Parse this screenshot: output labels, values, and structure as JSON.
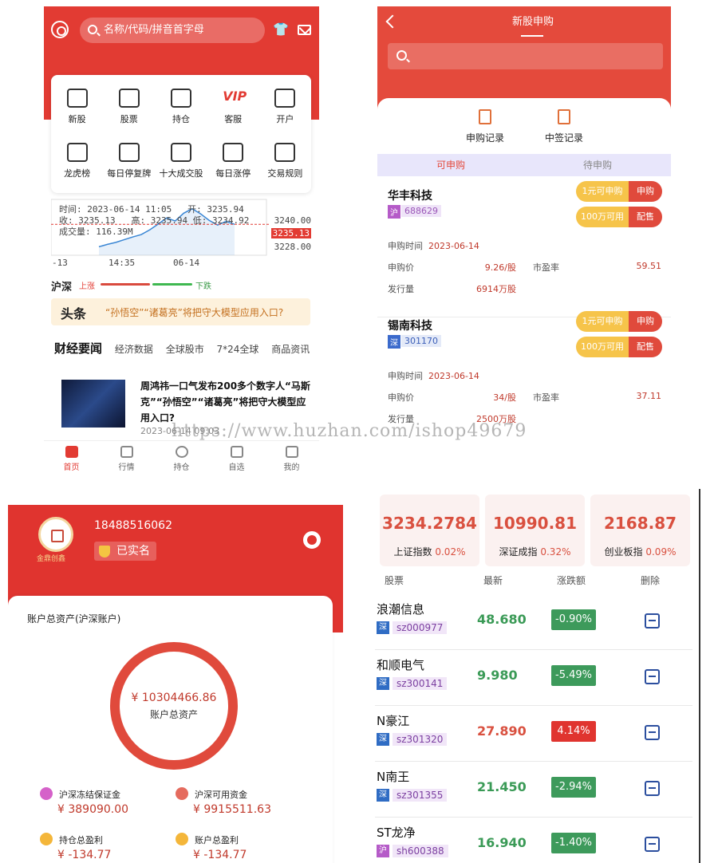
{
  "home": {
    "search_placeholder": "名称/代码/拼音首字母",
    "grid": [
      {
        "label": "新股",
        "icon": "ticket-icon"
      },
      {
        "label": "股票",
        "icon": "download-icon"
      },
      {
        "label": "持仓",
        "icon": "wallet-icon"
      },
      {
        "label": "客服",
        "icon": "vip-icon",
        "glyph": "VIP"
      },
      {
        "label": "开户",
        "icon": "user-coin-icon"
      },
      {
        "label": "龙虎榜",
        "icon": "badge-icon"
      },
      {
        "label": "每日停复牌",
        "icon": "star-icon"
      },
      {
        "label": "十大成交股",
        "icon": "crown-icon"
      },
      {
        "label": "每日涨停",
        "icon": "layers-icon"
      },
      {
        "label": "交易规则",
        "icon": "rules-icon"
      }
    ],
    "chart_info": {
      "time": "时间: 2023-06-14 11:05",
      "open": "开: 3235.94",
      "close": "收: 3235.13",
      "high": "高: 3235.94",
      "low": "低: 3234.92",
      "volume": "成交量: 116.39M"
    },
    "chart_data": {
      "type": "line",
      "x_ticks": [
        "-13",
        "14:35",
        "06-14"
      ],
      "y_ticks": [
        "3240.00",
        "3235.13",
        "3228.00"
      ],
      "current": "3235.13",
      "ylim": [
        3226,
        3242
      ],
      "values": [
        3228.5,
        3229.2,
        3229.8,
        3230.6,
        3231.4,
        3232.1,
        3233.5,
        3235.2,
        3237.0,
        3236.1,
        3238.4,
        3239.7,
        3238.2,
        3236.3,
        3234.9,
        3236.0,
        3235.13
      ]
    },
    "breadth": {
      "market": "沪深",
      "up": "上涨",
      "down": "下跌"
    },
    "banner": {
      "logo": "头条",
      "text": "“孙悟空”“诸葛亮”将把守大模型应用入口?"
    },
    "tabs": [
      "财经要闻",
      "经济数据",
      "全球股市",
      "7*24全球",
      "商品资讯"
    ],
    "news": {
      "title": "周鸿祎一口气发布200多个数字人“马斯克”“孙悟空”“诸葛亮”将把守大模型应用入口?",
      "time": "2023-06-14 09:03"
    },
    "nav": [
      "首页",
      "行情",
      "持仓",
      "自选",
      "我的"
    ]
  },
  "ipo": {
    "title": "新股申购",
    "actions": [
      "申购记录",
      "中签记录"
    ],
    "subtabs": [
      "可申购",
      "待申购"
    ],
    "items": [
      {
        "name": "华丰科技",
        "exchange": "沪",
        "code": "688629",
        "pill1_left": "1元可申购",
        "pill1_right": "申购",
        "pill2_left": "100万可用",
        "pill2_right": "配售",
        "date_label": "申购时间",
        "date": "2023-06-14",
        "price_label": "申购价",
        "price": "9.26/股",
        "pe_label": "市盈率",
        "pe": "59.51",
        "issue_label": "发行量",
        "issue": "6914万股"
      },
      {
        "name": "锡南科技",
        "exchange": "深",
        "code": "301170",
        "pill1_left": "1元可申购",
        "pill1_right": "申购",
        "pill2_left": "100万可用",
        "pill2_right": "配售",
        "date_label": "申购时间",
        "date": "2023-06-14",
        "price_label": "申购价",
        "price": "34/股",
        "pe_label": "市盈率",
        "pe": "37.11",
        "issue_label": "发行量",
        "issue": "2500万股"
      }
    ]
  },
  "account": {
    "logo_text": "金鼎创鑫",
    "phone": "18488516062",
    "verified": "已实名",
    "title": "账户总资产(沪深账户)",
    "total": "¥ 10304466.86",
    "total_label": "账户总资产",
    "stats": [
      {
        "label": "沪深冻结保证金",
        "value": "¥ 389090.00",
        "color": "#c0392b",
        "icon_color": "#d561c9"
      },
      {
        "label": "沪深可用资金",
        "value": "¥ 9915511.63",
        "color": "#c0392b",
        "icon_color": "#e56b5e"
      },
      {
        "label": "持仓总盈利",
        "value": "¥ -134.77",
        "color": "#c0392b",
        "icon_color": "#f4b63a"
      },
      {
        "label": "账户总盈利",
        "value": "¥ -134.77",
        "color": "#c0392b",
        "icon_color": "#f4b63a"
      }
    ]
  },
  "watch": {
    "indices": [
      {
        "value": "3234.2784",
        "name": "上证指数",
        "pct": "0.02%"
      },
      {
        "value": "10990.81",
        "name": "深证成指",
        "pct": "0.32%"
      },
      {
        "value": "2168.87",
        "name": "创业板指",
        "pct": "0.09%"
      }
    ],
    "headers": [
      "股票",
      "最新",
      "涨跌额",
      "删除"
    ],
    "rows": [
      {
        "name": "浪潮信息",
        "exchange": "深",
        "code": "sz000977",
        "price": "48.680",
        "change": "-0.90%",
        "up": false
      },
      {
        "name": "和顺电气",
        "exchange": "深",
        "code": "sz300141",
        "price": "9.980",
        "change": "-5.49%",
        "up": false
      },
      {
        "name": "N豪江",
        "exchange": "深",
        "code": "sz301320",
        "price": "27.890",
        "change": "4.14%",
        "up": true
      },
      {
        "name": "N南王",
        "exchange": "深",
        "code": "sz301355",
        "price": "21.450",
        "change": "-2.94%",
        "up": false
      },
      {
        "name": "ST龙净",
        "exchange": "沪",
        "code": "sh600388",
        "price": "16.940",
        "change": "-1.40%",
        "up": false
      }
    ],
    "colors": {
      "up": "#d9503f",
      "down": "#3a9a56",
      "down_badge": "#3d9a5b",
      "up_badge": "#e0342f"
    }
  },
  "watermark": "https://www.huzhan.com/ishop49679"
}
